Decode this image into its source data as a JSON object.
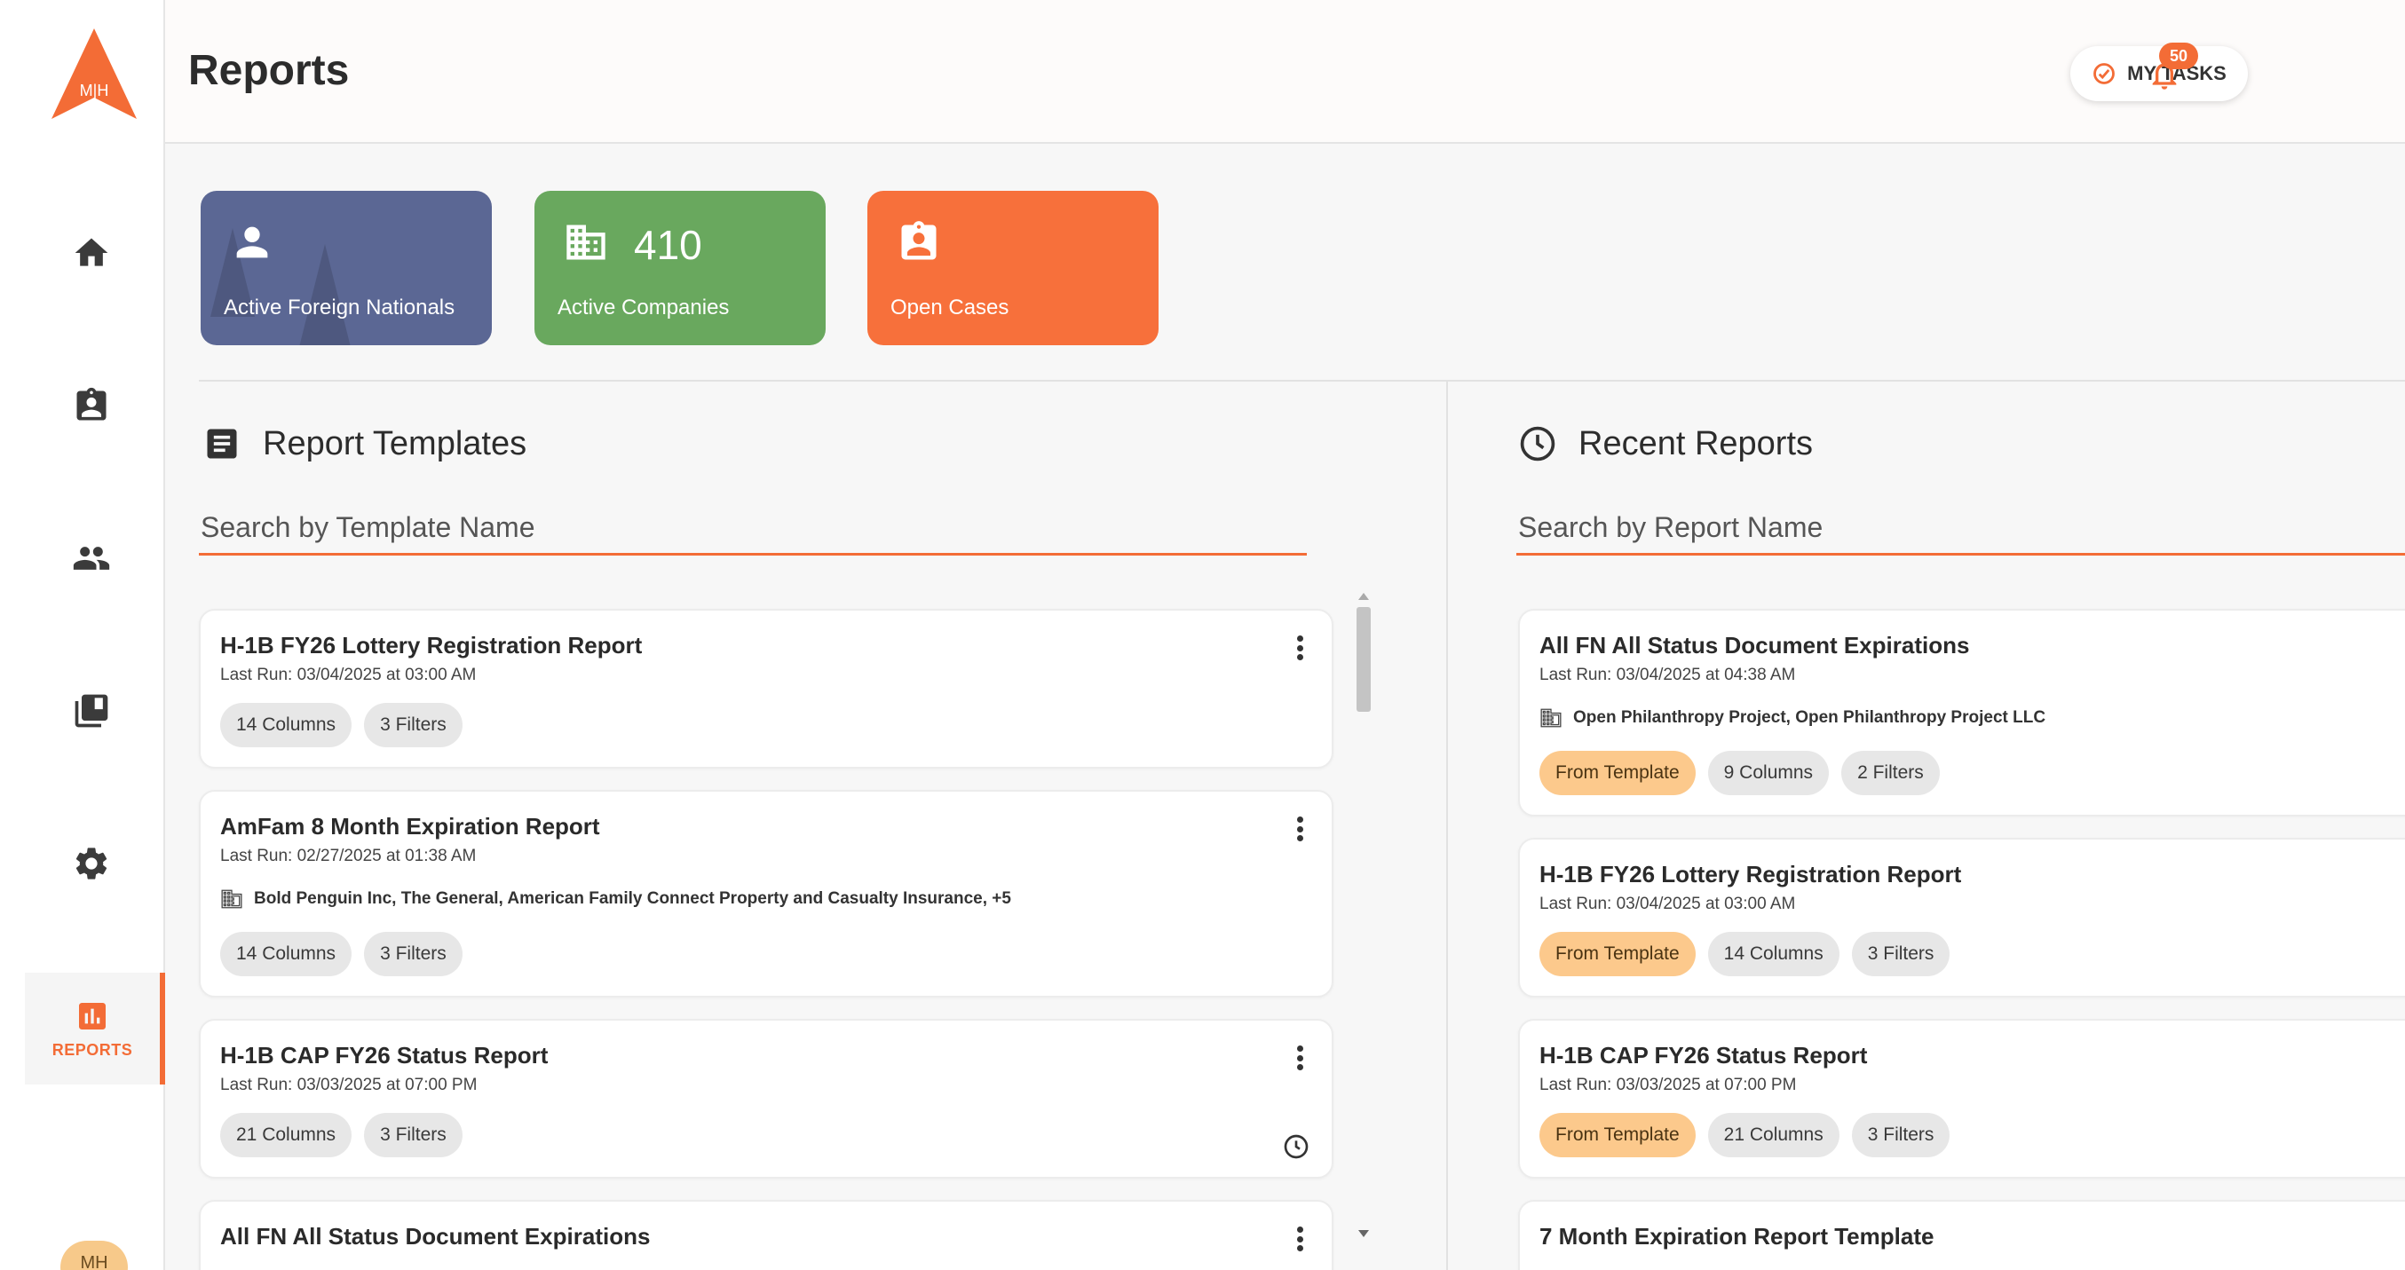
{
  "header": {
    "title": "Reports",
    "tasks_label": "MY TASKS",
    "notification_count": "50"
  },
  "logo": {
    "initials": "M|H"
  },
  "sidebar": {
    "items": [
      {
        "icon": "home-icon"
      },
      {
        "icon": "clipboard-person-icon"
      },
      {
        "icon": "people-icon"
      },
      {
        "icon": "library-books-icon"
      },
      {
        "icon": "gear-icon"
      },
      {
        "icon": "bar-chart-icon",
        "label": "REPORTS",
        "active": true
      }
    ],
    "avatar": "MH"
  },
  "stats": [
    {
      "label": "Active Foreign Nationals",
      "value": "",
      "color": "#5b6794",
      "icon": "person-icon"
    },
    {
      "label": "Active Companies",
      "value": "410",
      "color": "#69a85e",
      "icon": "building-icon"
    },
    {
      "label": "Open Cases",
      "value": "",
      "color": "#f7703b",
      "icon": "clipboard-person-icon"
    }
  ],
  "templates": {
    "title": "Report Templates",
    "search_placeholder": "Search by Template Name",
    "items": [
      {
        "title": "H-1B FY26 Lottery Registration Report",
        "last_run": "Last Run:  03/04/2025 at 03:00 AM",
        "columns": "14 Columns",
        "filters": "3 Filters"
      },
      {
        "title": "AmFam 8 Month Expiration Report",
        "last_run": "Last Run:  02/27/2025 at 01:38 AM",
        "companies": "Bold Penguin Inc,  The General,  American Family Connect Property and Casualty Insurance,  +5",
        "columns": "14 Columns",
        "filters": "3 Filters"
      },
      {
        "title": "H-1B CAP FY26 Status Report",
        "last_run": "Last Run:  03/03/2025 at 07:00 PM",
        "columns": "21 Columns",
        "filters": "3 Filters"
      },
      {
        "title": "All FN All Status Document Expirations"
      }
    ]
  },
  "recent": {
    "title": "Recent Reports",
    "search_placeholder": "Search by Report Name",
    "items": [
      {
        "title": "All FN All Status Document Expirations",
        "last_run": "Last Run:  03/04/2025 at 04:38 AM",
        "companies": "Open Philanthropy Project,  Open Philanthropy Project LLC",
        "template": "From Template",
        "columns": "9 Columns",
        "filters": "2 Filters"
      },
      {
        "title": "H-1B FY26 Lottery Registration Report",
        "last_run": "Last Run:  03/04/2025 at 03:00 AM",
        "template": "From Template",
        "columns": "14 Columns",
        "filters": "3 Filters"
      },
      {
        "title": "H-1B CAP FY26 Status Report",
        "last_run": "Last Run:  03/03/2025 at 07:00 PM",
        "template": "From Template",
        "columns": "21 Columns",
        "filters": "3 Filters"
      },
      {
        "title": "7 Month Expiration Report Template"
      }
    ]
  },
  "colors": {
    "accent": "#f36c36",
    "template_chip": "#fcc98c"
  }
}
